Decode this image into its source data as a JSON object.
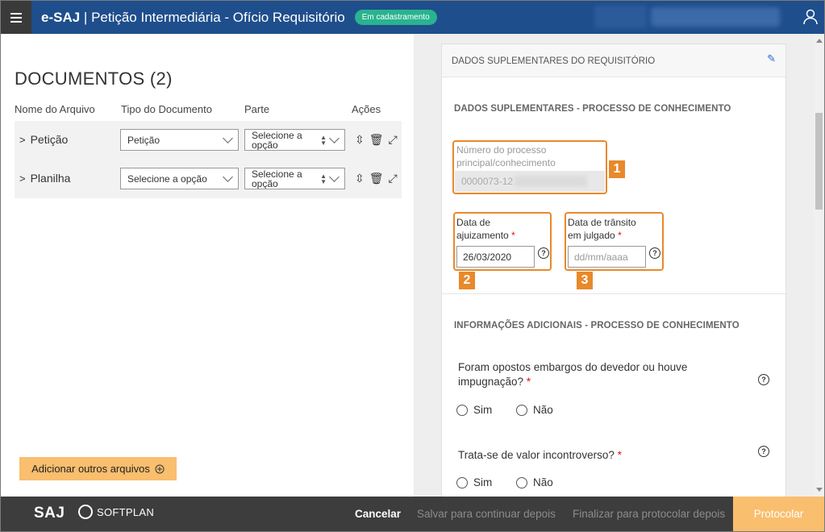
{
  "header": {
    "brand": "e-SAJ",
    "title": "Petição Intermediária - Ofício Requisitório",
    "status_badge": "Em cadastramento"
  },
  "documents": {
    "title": "DOCUMENTOS (2)",
    "columns": [
      "Nome do Arquivo",
      "Tipo do Documento",
      "Parte",
      "Ações"
    ],
    "rows": [
      {
        "name": "Petição",
        "tipo": "Petição",
        "parte": "Selecione a opção"
      },
      {
        "name": "Planilha",
        "tipo": "Selecione a opção",
        "parte": "Selecione a opção"
      }
    ],
    "add_button": "Adicionar outros arquivos"
  },
  "supplementary": {
    "card_title": "DADOS SUPLEMENTARES DO REQUISITÓRIO",
    "section1_title": "DADOS SUPLEMENTARES - PROCESSO DE CONHECIMENTO",
    "processo_label_1": "Número do processo",
    "processo_label_2": "principal/conhecimento",
    "processo_value": "0000073-12",
    "ajuizamento_label_1": "Data de",
    "ajuizamento_label_2": "ajuizamento",
    "ajuizamento_value": "26/03/2020",
    "transito_label_1": "Data de trânsito",
    "transito_label_2": "em julgado",
    "transito_placeholder": "dd/mm/aaaa",
    "required_mark": "*",
    "help_glyph": "?",
    "callouts": [
      "1",
      "2",
      "3"
    ],
    "section2_title": "INFORMAÇÕES ADICIONAIS - PROCESSO DE CONHECIMENTO",
    "q1_line1": "Foram opostos embargos do devedor ou houve",
    "q1_line2": "impugnação?",
    "q2": "Trata-se de valor incontroverso?",
    "yes": "Sim",
    "no": "Não"
  },
  "footer": {
    "logo_saj": "SAJ",
    "logo_softplan": "SOFTPLAN",
    "cancel": "Cancelar",
    "save_later": "Salvar para continuar depois",
    "finalize_later": "Finalizar para protocolar depois",
    "submit": "Protocolar"
  },
  "colors": {
    "header_bg": "#1f4e8c",
    "badge": "#29b38f",
    "accent_orange": "#e8892b",
    "button_orange": "#f9be6e",
    "footer_bg": "#3d3d3d"
  }
}
